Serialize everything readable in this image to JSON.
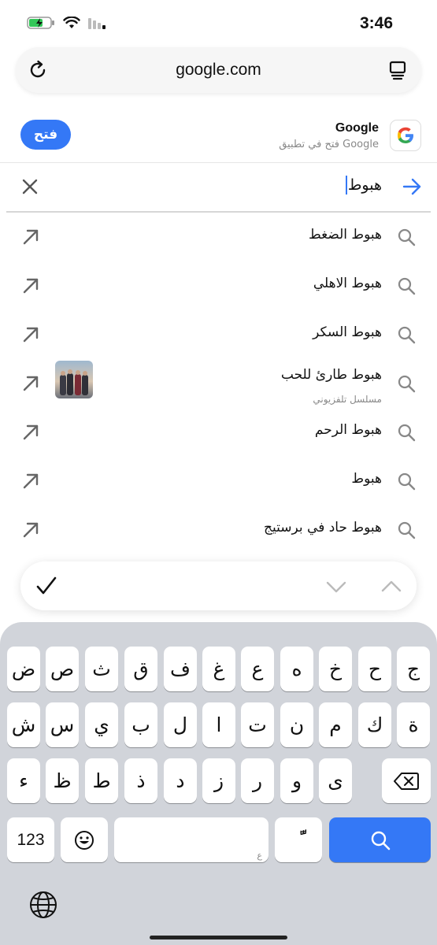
{
  "status": {
    "time": "3:46"
  },
  "url_bar": {
    "url": "google.com"
  },
  "app_banner": {
    "title": "Google",
    "subtitle": "فتح في تطبيق Google",
    "open_label": "فتح"
  },
  "search": {
    "query": "هبوط"
  },
  "suggestions": [
    {
      "text": "هبوط الضغط",
      "subtitle": ""
    },
    {
      "text": "هبوط الاهلي",
      "subtitle": ""
    },
    {
      "text": "هبوط السكر",
      "subtitle": ""
    },
    {
      "text": "هبوط طارئ للحب",
      "subtitle": "مسلسل تلفزيوني"
    },
    {
      "text": "هبوط الرحم",
      "subtitle": ""
    },
    {
      "text": "هبوط",
      "subtitle": ""
    },
    {
      "text": "هبوط حاد في برستيج",
      "subtitle": ""
    }
  ],
  "keyboard": {
    "row1": [
      "ض",
      "ص",
      "ث",
      "ق",
      "ف",
      "غ",
      "ع",
      "ه",
      "خ",
      "ح",
      "ج"
    ],
    "row2": [
      "ش",
      "س",
      "ي",
      "ب",
      "ل",
      "ا",
      "ت",
      "ن",
      "م",
      "ك",
      "ة"
    ],
    "row3": [
      "ء",
      "ظ",
      "ط",
      "ذ",
      "د",
      "ز",
      "ر",
      "و",
      "ى"
    ],
    "numbers_label": "123",
    "space_hint": "ع",
    "diacritic_label": "ًّ"
  },
  "colors": {
    "accent": "#3478f6",
    "keyboard_bg": "#d1d4da"
  }
}
